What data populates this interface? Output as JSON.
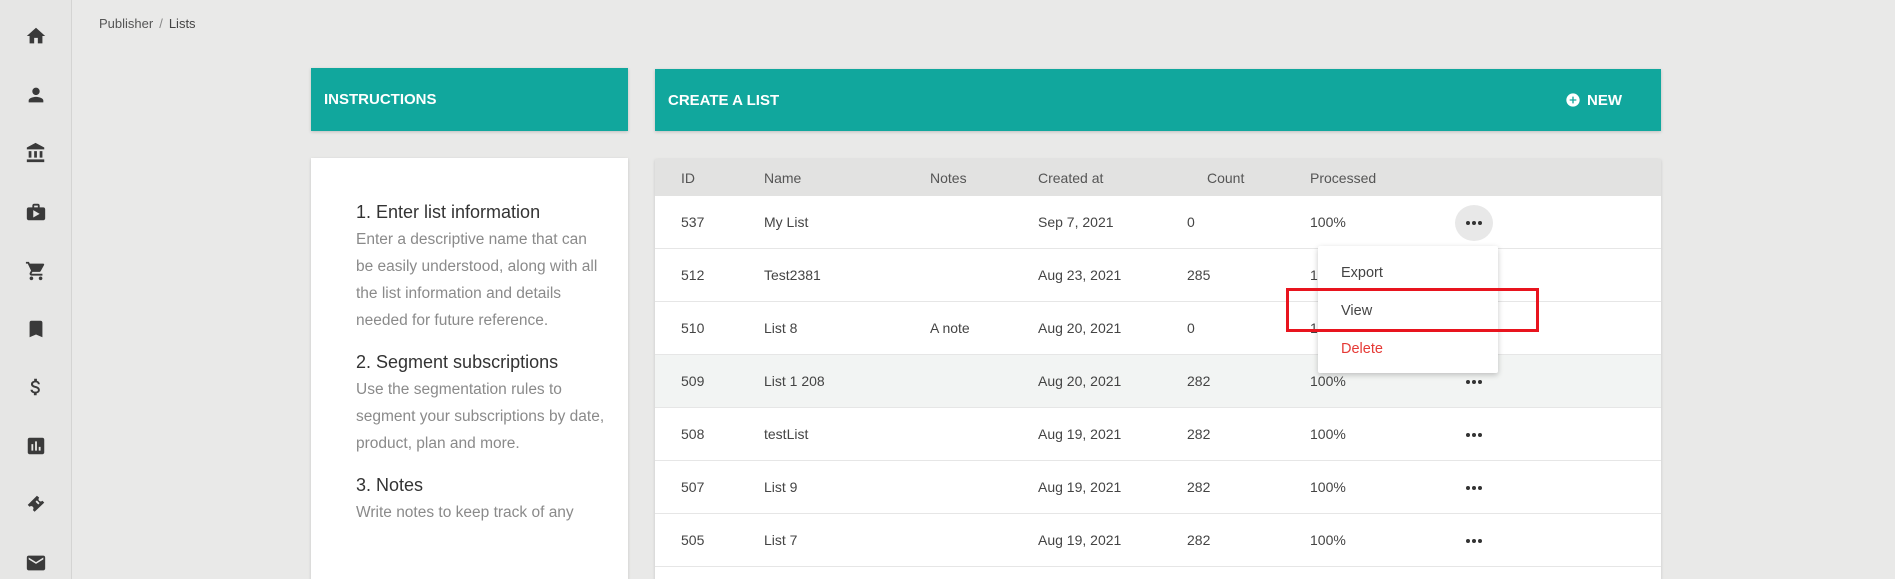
{
  "sidebar": {
    "items": [
      {
        "icon": "home-icon"
      },
      {
        "icon": "user-icon"
      },
      {
        "icon": "bank-icon"
      },
      {
        "icon": "media-bag-icon"
      },
      {
        "icon": "cart-icon"
      },
      {
        "icon": "bookmark-icon"
      },
      {
        "icon": "dollar-icon"
      },
      {
        "icon": "chart-icon"
      },
      {
        "icon": "ticket-icon"
      },
      {
        "icon": "mail-icon"
      }
    ]
  },
  "breadcrumb": {
    "root": "Publisher",
    "separator": "/",
    "current": "Lists"
  },
  "instructions": {
    "title": "INSTRUCTIONS",
    "steps": [
      {
        "title": "1. Enter list information",
        "desc": "Enter a descriptive name that can be easily understood, along with all the list information and details needed for future reference."
      },
      {
        "title": "2. Segment subscriptions",
        "desc": "Use the segmentation rules to segment your subscriptions by date, product, plan and more."
      },
      {
        "title": "3. Notes",
        "desc": "Write notes to keep track of any"
      }
    ]
  },
  "list_panel": {
    "title": "CREATE A LIST",
    "new_label": "NEW",
    "columns": [
      "ID",
      "Name",
      "Notes",
      "Created at",
      "Count",
      "Processed"
    ],
    "rows": [
      {
        "id": "537",
        "name": "My List",
        "notes": "",
        "created": "Sep 7, 2021",
        "count": "0",
        "processed": "100%"
      },
      {
        "id": "512",
        "name": "Test2381",
        "notes": "",
        "created": "Aug 23, 2021",
        "count": "285",
        "processed": "1"
      },
      {
        "id": "510",
        "name": "List 8",
        "notes": "A note",
        "created": "Aug 20, 2021",
        "count": "0",
        "processed": "1"
      },
      {
        "id": "509",
        "name": "List 1 208",
        "notes": "",
        "created": "Aug 20, 2021",
        "count": "282",
        "processed": "100%"
      },
      {
        "id": "508",
        "name": "testList",
        "notes": "",
        "created": "Aug 19, 2021",
        "count": "282",
        "processed": "100%"
      },
      {
        "id": "507",
        "name": "List 9",
        "notes": "",
        "created": "Aug 19, 2021",
        "count": "282",
        "processed": "100%"
      },
      {
        "id": "505",
        "name": "List 7",
        "notes": "",
        "created": "Aug 19, 2021",
        "count": "282",
        "processed": "100%"
      }
    ]
  },
  "row_menu": {
    "items": [
      "Export",
      "View",
      "Delete"
    ]
  },
  "colors": {
    "accent": "#11a79d",
    "danger": "#e53935",
    "highlight": "#e8141e"
  }
}
